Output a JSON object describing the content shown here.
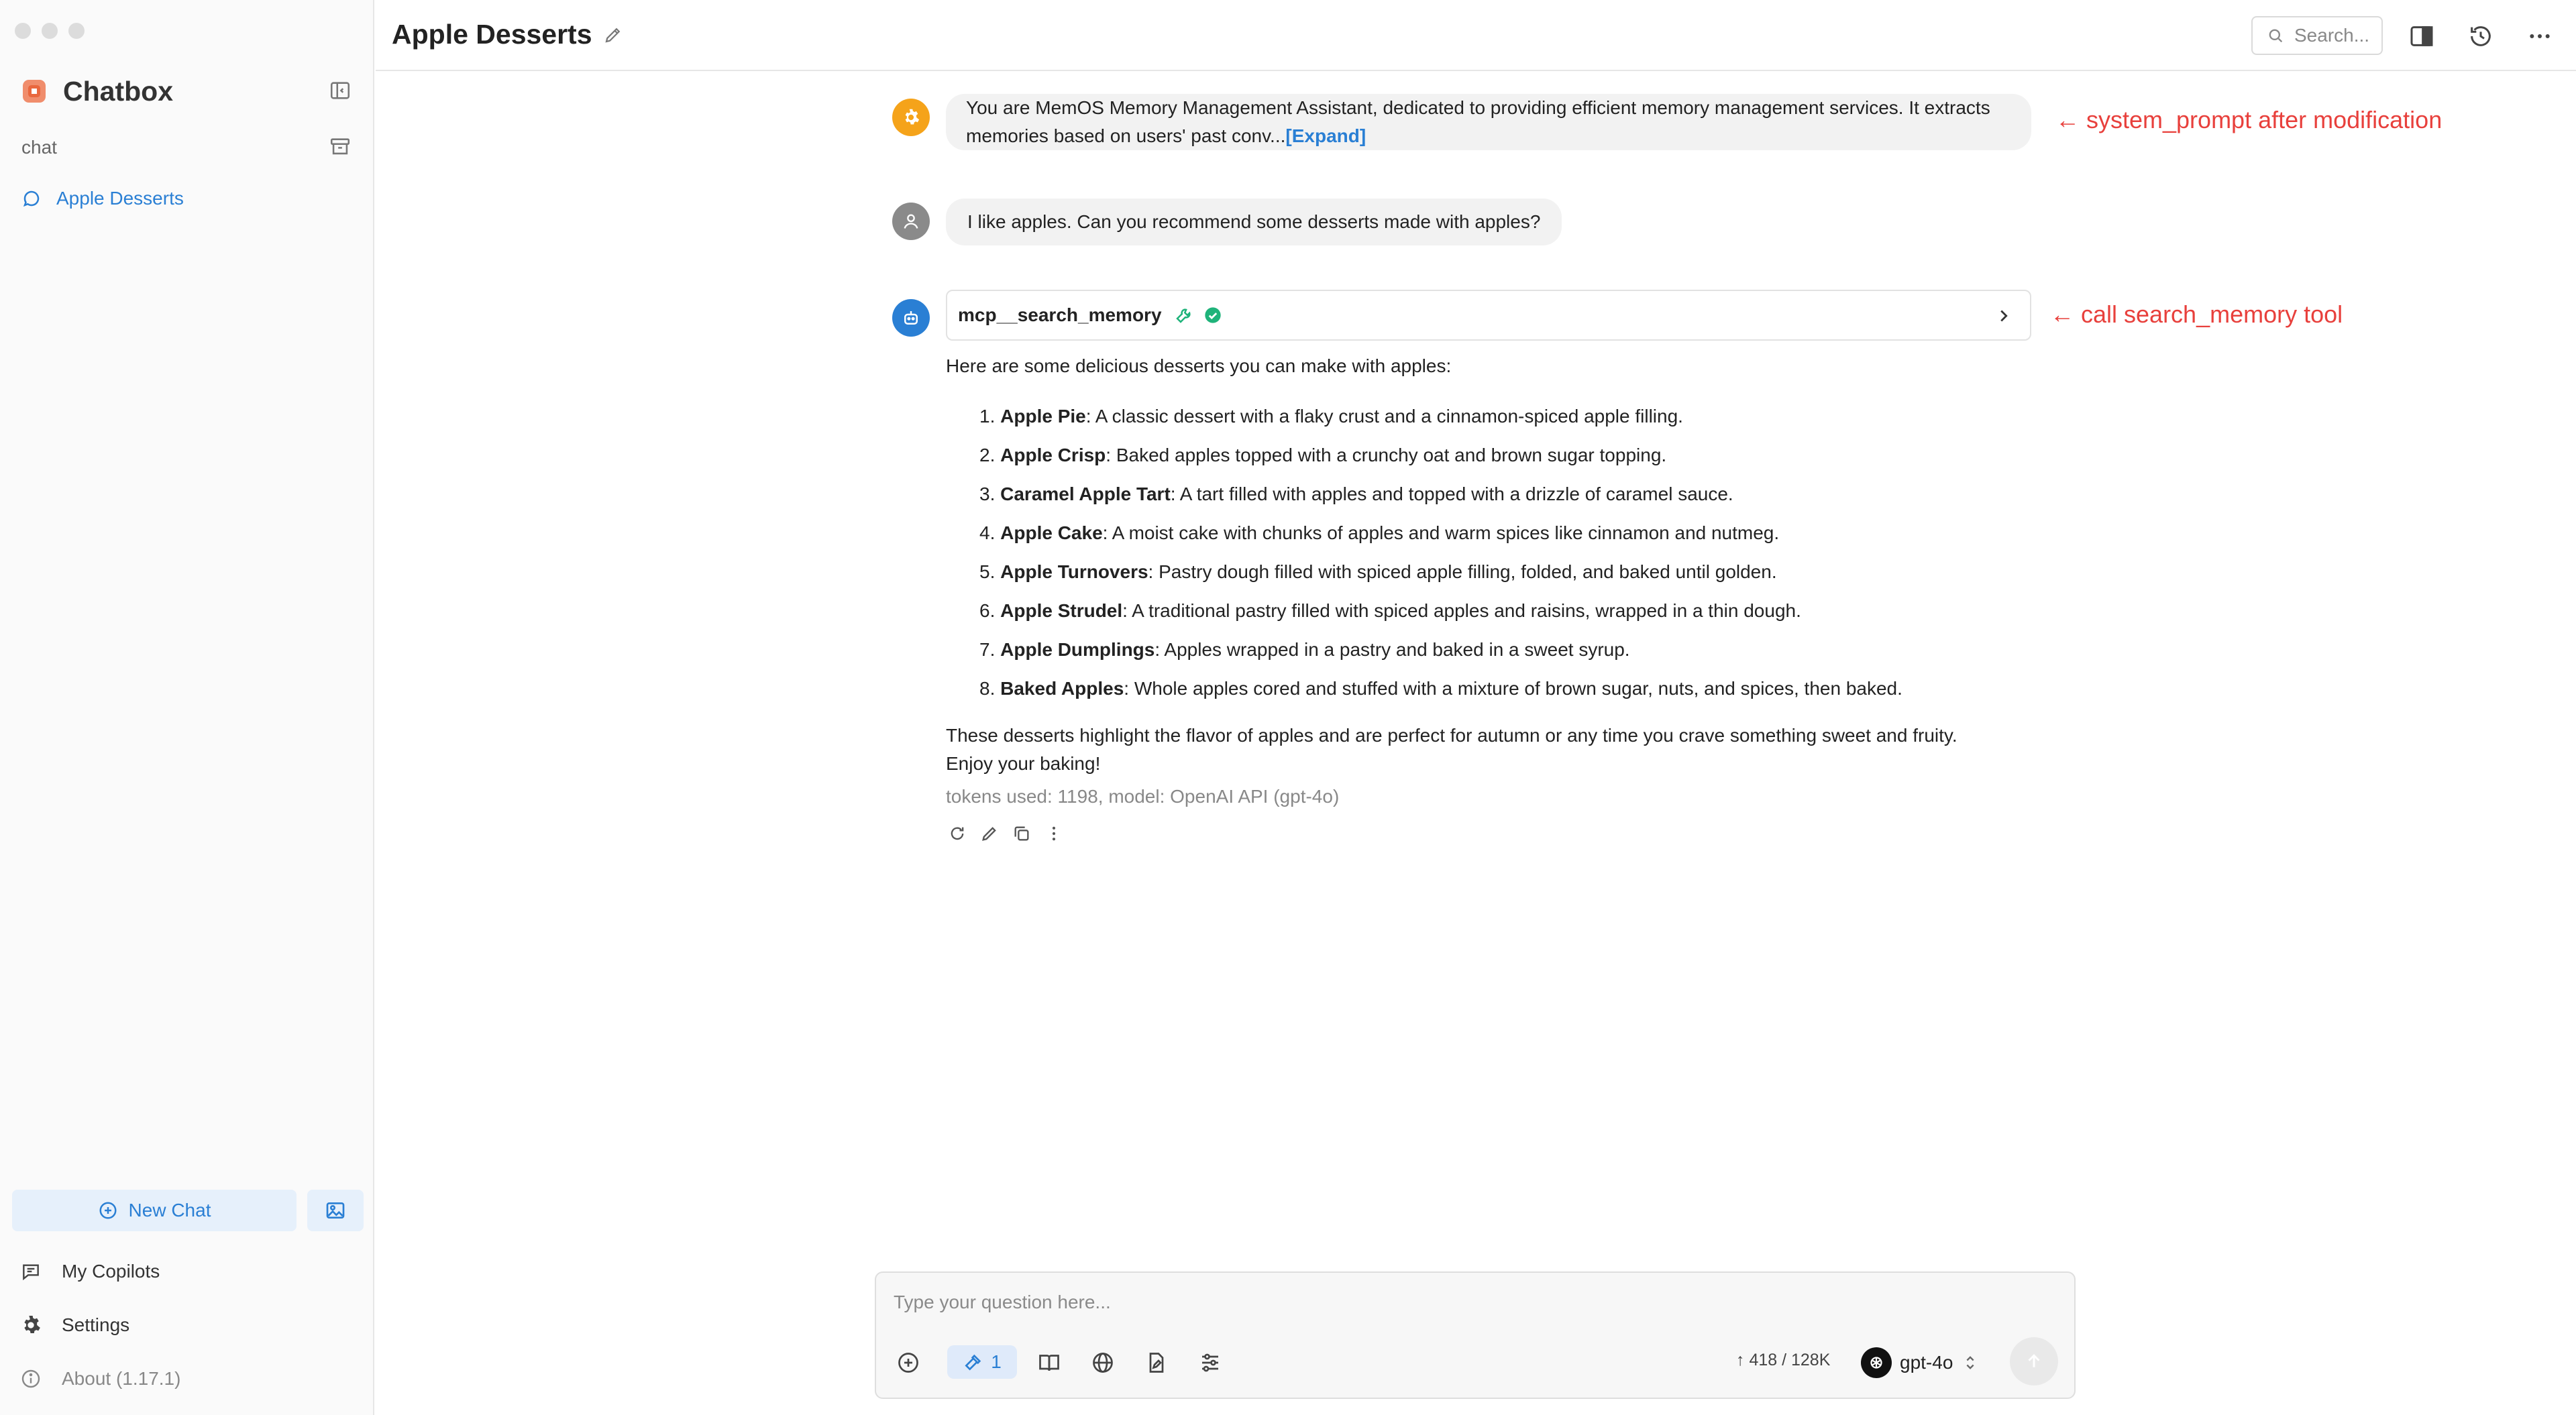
{
  "sidebar": {
    "brand": "Chatbox",
    "section_label": "chat",
    "sessions": [
      {
        "label": "Apple Desserts"
      }
    ],
    "new_chat_label": "New Chat",
    "nav": [
      {
        "label": "My Copilots"
      },
      {
        "label": "Settings"
      },
      {
        "label": "About (1.17.1)"
      }
    ]
  },
  "header": {
    "title": "Apple Desserts",
    "search_placeholder": "Search..."
  },
  "messages": {
    "system": {
      "text": "You are MemOS Memory Management Assistant, dedicated to providing efficient memory management services. It extracts memories based on users' past conv...",
      "expand_label": "[Expand]",
      "annotation": "← system_prompt after modification"
    },
    "user": {
      "text": "I like apples. Can you recommend some desserts made with apples?"
    },
    "assistant": {
      "tool_call": {
        "name": "mcp__search_memory",
        "annotation": "← call search_memory tool"
      },
      "intro": "Here are some delicious desserts you can make with apples:",
      "items": [
        {
          "num": "1.",
          "name": "Apple Pie",
          "desc": ": A classic dessert with a flaky crust and a cinnamon-spiced apple filling."
        },
        {
          "num": "2.",
          "name": "Apple Crisp",
          "desc": ": Baked apples topped with a crunchy oat and brown sugar topping."
        },
        {
          "num": "3.",
          "name": "Caramel Apple Tart",
          "desc": ": A tart filled with apples and topped with a drizzle of caramel sauce."
        },
        {
          "num": "4.",
          "name": "Apple Cake",
          "desc": ": A moist cake with chunks of apples and warm spices like cinnamon and nutmeg."
        },
        {
          "num": "5.",
          "name": "Apple Turnovers",
          "desc": ": Pastry dough filled with spiced apple filling, folded, and baked until golden."
        },
        {
          "num": "6.",
          "name": "Apple Strudel",
          "desc": ": A traditional pastry filled with spiced apples and raisins, wrapped in a thin dough."
        },
        {
          "num": "7.",
          "name": "Apple Dumplings",
          "desc": ": Apples wrapped in a pastry and baked in a sweet syrup."
        },
        {
          "num": "8.",
          "name": "Baked Apples",
          "desc": ": Whole apples cored and stuffed with a mixture of brown sugar, nuts, and spices, then baked."
        }
      ],
      "outro_line1": "These desserts highlight the flavor of apples and are perfect for autumn or any time you crave something sweet and fruity.",
      "outro_line2": "Enjoy your baking!",
      "meta": "tokens used: 1198, model: OpenAI API (gpt-4o)"
    }
  },
  "input": {
    "placeholder": "Type your question here...",
    "tools_count": "1",
    "token_count": "418 / 128K",
    "model": "gpt-4o"
  },
  "colors": {
    "accent": "#2a7fd4",
    "annotation": "#e8403c",
    "system_avatar": "#f5a31a",
    "user_avatar": "#8a8a8a",
    "assistant_avatar": "#2a7fd4",
    "tool_ok": "#1fb37a"
  }
}
